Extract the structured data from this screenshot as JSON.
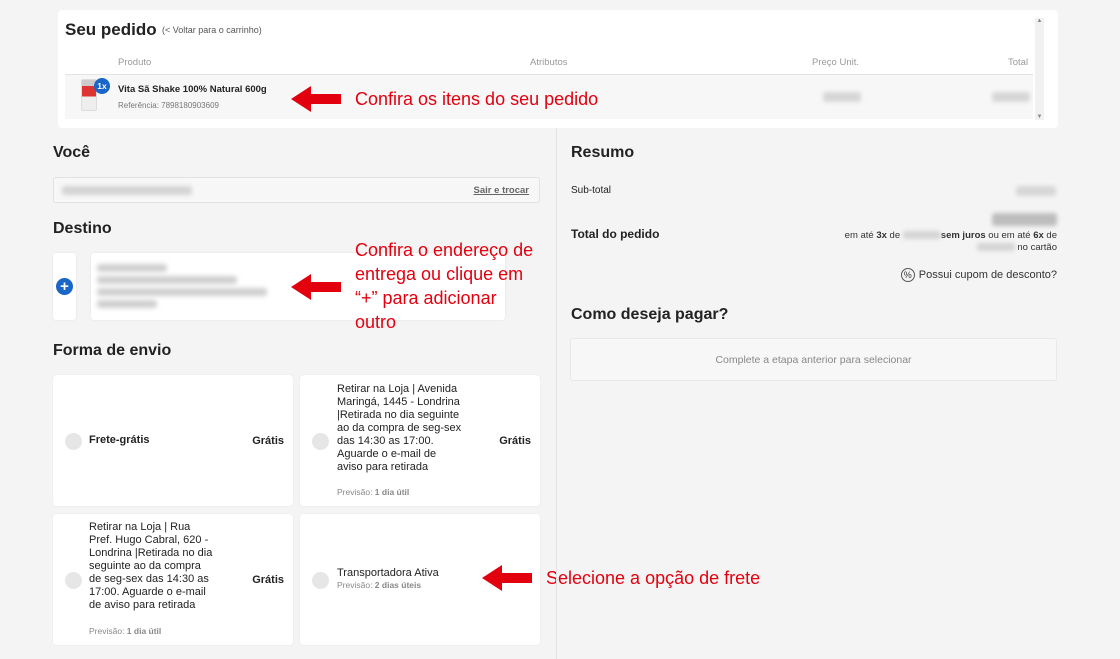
{
  "order": {
    "title": "Seu pedido",
    "back_link": "(< Voltar para o carrinho)",
    "columns": [
      "Produto",
      "Atributos",
      "Preço Unit.",
      "Total"
    ],
    "items": [
      {
        "qty": "1x",
        "name": "Vita Sã Shake 100% Natural 600g",
        "reference": "Referência: 7898180903609"
      }
    ]
  },
  "you": {
    "title": "Você",
    "logout_link": "Sair e trocar"
  },
  "destination": {
    "title": "Destino",
    "add_symbol": "+"
  },
  "shipping": {
    "title": "Forma de envio",
    "options": [
      {
        "label": "Frete-grátis",
        "price": "Grátis",
        "eta_prefix": "",
        "eta_value": ""
      },
      {
        "label": "Retirar na Loja | Avenida Maringá, 1445 - Londrina |Retirada no dia seguinte ao da compra de seg-sex das 14:30 as 17:00. Aguarde o e-mail de aviso para retirada",
        "price": "Grátis",
        "eta_prefix": "Previsão: ",
        "eta_value": "1 dia útil"
      },
      {
        "label": "Retirar na Loja | Rua Pref. Hugo Cabral, 620 - Londrina |Retirada no dia seguinte ao da compra de seg-sex das 14:30 as 17:00. Aguarde o e-mail de aviso para retirada",
        "price": "Grátis",
        "eta_prefix": "Previsão: ",
        "eta_value": "1 dia útil"
      },
      {
        "label": "Transportadora Ativa",
        "price": "",
        "eta_prefix": "Previsão: ",
        "eta_value": "2 dias úteis"
      }
    ]
  },
  "summary": {
    "title": "Resumo",
    "subtotal_label": "Sub-total",
    "total_label": "Total do pedido",
    "inst_1": "em até ",
    "inst_2": "3x",
    "inst_3": " de ",
    "inst_4": "sem juros",
    "inst_5": " ou em até ",
    "inst_6": "6x",
    "inst_7": " de",
    "inst_8": " no cartão",
    "coupon": "Possui cupom de desconto?"
  },
  "payment": {
    "title": "Como deseja pagar?",
    "placeholder": "Complete a etapa anterior para selecionar"
  },
  "annotations": {
    "items": "Confira os itens do seu pedido",
    "address": "Confira o endereço de entrega ou clique em “+” para adicionar outro",
    "shipping": "Selecione a opção de frete"
  },
  "colors": {
    "accent_blue": "#1a66c8",
    "annotation_red": "#e2000f"
  },
  "icons": [
    "cart-back-icon",
    "plus-icon",
    "coupon-percent-icon",
    "arrow-left-icon"
  ]
}
